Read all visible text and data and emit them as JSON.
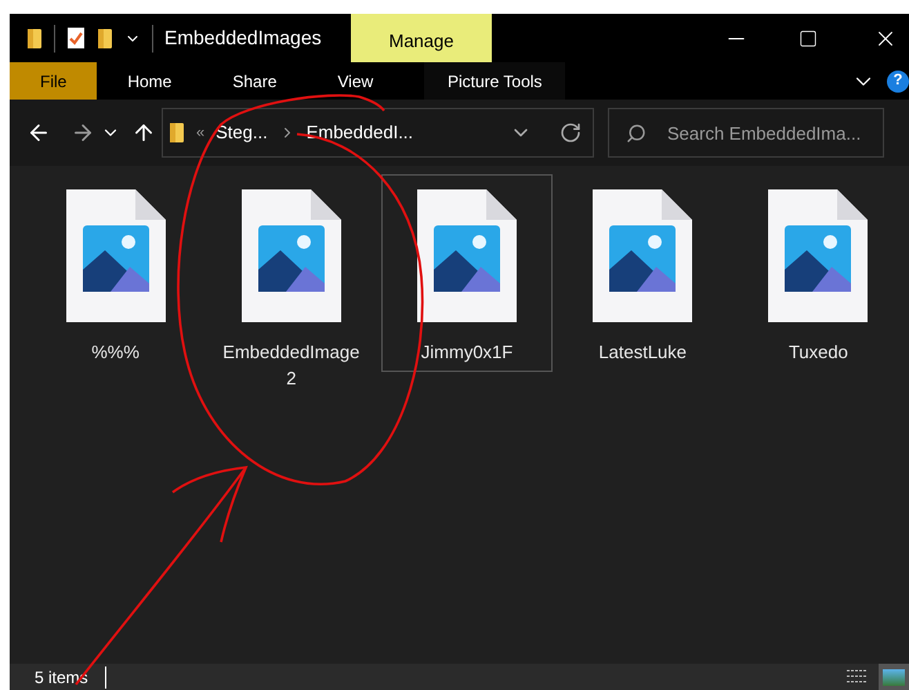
{
  "window": {
    "title": "EmbeddedImages",
    "context_tab": "Manage",
    "help": "?"
  },
  "ribbon_tabs": [
    {
      "label": "File",
      "selected": true
    },
    {
      "label": "Home",
      "selected": false
    },
    {
      "label": "Share",
      "selected": false
    },
    {
      "label": "View",
      "selected": false
    },
    {
      "label": "Picture Tools",
      "selected": false
    }
  ],
  "address_bar": {
    "overflow": "«",
    "path": [
      "Steg...",
      "EmbeddedI..."
    ]
  },
  "search": {
    "placeholder": "Search EmbeddedIma..."
  },
  "files": [
    {
      "name": "%%%",
      "selected": false
    },
    {
      "name": "EmbeddedImage\n2",
      "selected": false
    },
    {
      "name": "Jimmy0x1F",
      "selected": true
    },
    {
      "name": "LatestLuke",
      "selected": false
    },
    {
      "name": "Tuxedo",
      "selected": false
    }
  ],
  "status_bar": {
    "count": "5 items"
  }
}
